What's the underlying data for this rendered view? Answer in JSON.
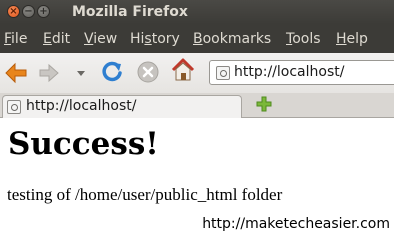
{
  "window": {
    "title": "Mozilla Firefox",
    "controls": {
      "close": "×",
      "minimize": "−",
      "maximize": "+"
    }
  },
  "menu": {
    "items": [
      {
        "underline": "F",
        "rest": "ile"
      },
      {
        "underline": "E",
        "rest": "dit"
      },
      {
        "underline": "V",
        "rest": "iew"
      },
      {
        "pre": "Hi",
        "underline": "s",
        "rest": "tory"
      },
      {
        "underline": "B",
        "rest": "ookmarks"
      },
      {
        "underline": "T",
        "rest": "ools"
      },
      {
        "underline": "H",
        "rest": "elp"
      }
    ]
  },
  "toolbar": {
    "icons": [
      "back-arrow-icon",
      "forward-arrow-icon",
      "history-dropdown-icon",
      "reload-icon",
      "stop-icon",
      "home-icon"
    ],
    "url": "http://localhost/"
  },
  "tabs": [
    {
      "label": "http://localhost/"
    }
  ],
  "page": {
    "heading": "Success!",
    "body": "testing of /home/user/public_html folder"
  },
  "watermark": "http://maketecheasier.com",
  "colors": {
    "titlebar": "#3c3b37",
    "menu_text": "#dfdbd2",
    "close_button": "#e0571e",
    "back_arrow": "#e8851c",
    "reload": "#2f7fd0",
    "new_tab": "#7bb83a"
  }
}
